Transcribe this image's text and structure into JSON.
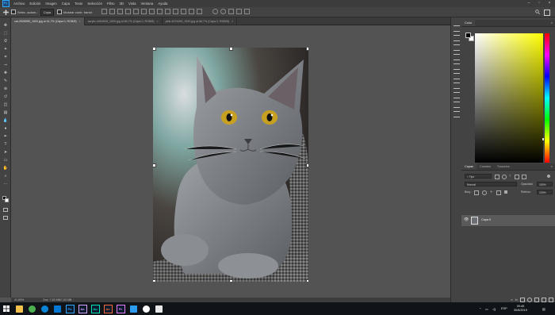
{
  "menubar": {
    "logo": "Ps",
    "items": [
      "Archivo",
      "Edición",
      "Imagen",
      "Capa",
      "Texto",
      "Selección",
      "Filtro",
      "3D",
      "Vista",
      "Ventana",
      "Ayuda"
    ]
  },
  "options": {
    "auto_select_label": "Selec. autom.:",
    "auto_select_value": "Capa",
    "transform_label": "Mostrar contr. transf."
  },
  "tabs": [
    {
      "label": "cat-2528955_1920.jpg al 41,7% (Capa 0, RGB/8)",
      "active": true
    },
    {
      "label": "acrylic-4404926_1920.jpg al 66,7% (Capa 0, RGB/8)",
      "active": false
    },
    {
      "label": "pink-4974490_1920.jpg al 66,7% (Capa 0, RGB/8)",
      "active": false
    }
  ],
  "status": {
    "zoom": "41,69%",
    "doc": "Doc: 7,63 MB/7,63 MB"
  },
  "panels": {
    "color_tab": "Color",
    "layers_tabs": [
      "Capas",
      "Canales",
      "Trazados"
    ],
    "kind_filter": "Tipo",
    "blend_mode": "Normal",
    "opacity_label": "Opacidad:",
    "opacity_value": "100%",
    "lock_label": "Bloq.:",
    "fill_label": "Relleno:",
    "fill_value": "100%",
    "layer_name": "Capa 0"
  },
  "taskbar": {
    "apps": [
      {
        "name": "explorer",
        "label": "",
        "color": "#f2c14e"
      },
      {
        "name": "chrome",
        "label": "",
        "color": "#4caf50"
      },
      {
        "name": "edge",
        "label": "",
        "color": "#0a84d6"
      },
      {
        "name": "store",
        "label": "",
        "color": "#0078d4"
      },
      {
        "name": "photoshop",
        "label": "Ps",
        "color": "#31a8ff"
      },
      {
        "name": "after-effects",
        "label": "Ae",
        "color": "#d6a6ff"
      },
      {
        "name": "audition",
        "label": "Au",
        "color": "#00e4bb"
      },
      {
        "name": "animate",
        "label": "An",
        "color": "#ff6a3d"
      },
      {
        "name": "premiere",
        "label": "Pr",
        "color": "#e77cff"
      },
      {
        "name": "vscode",
        "label": "",
        "color": "#2d9bf0"
      },
      {
        "name": "discord",
        "label": "",
        "color": "#ffffff"
      },
      {
        "name": "ufo",
        "label": "",
        "color": "#e8e8e8"
      }
    ],
    "language": "ESP",
    "time": "09:45",
    "date": "30/8/2019"
  }
}
